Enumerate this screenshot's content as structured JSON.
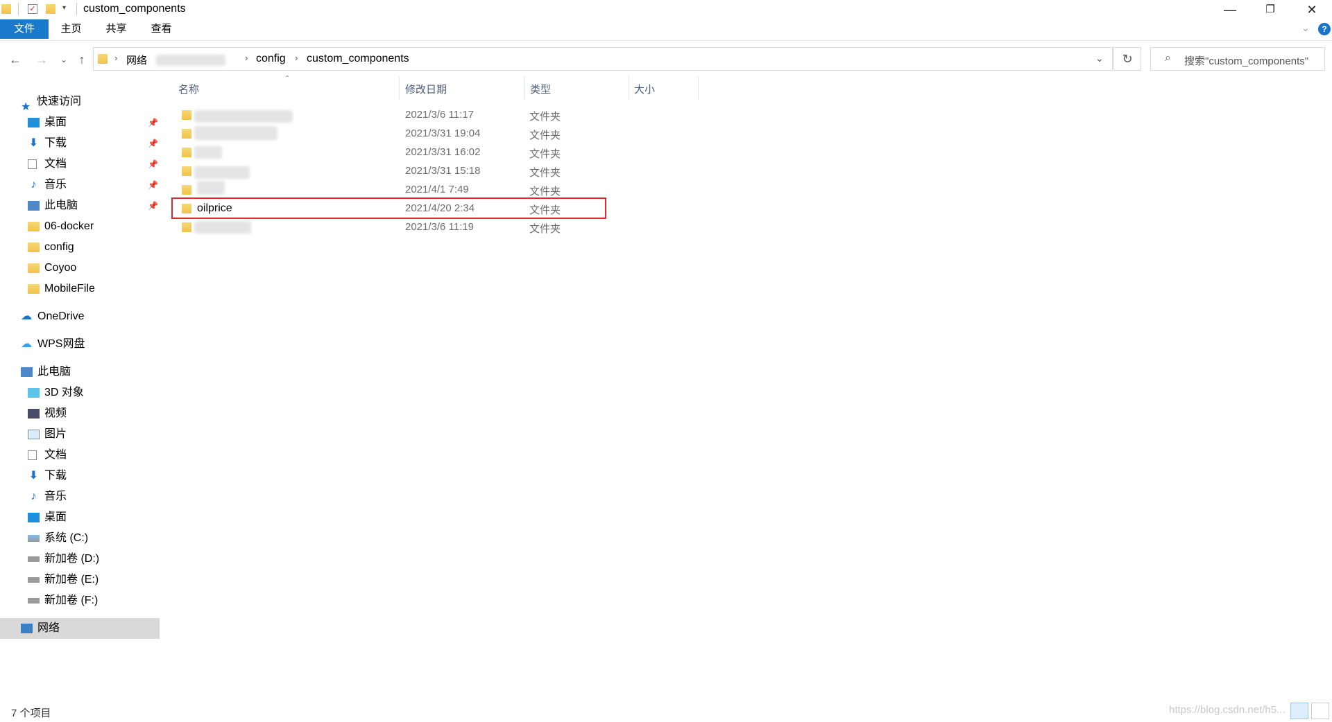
{
  "window": {
    "title": "custom_components",
    "controls": {
      "minimize": "—",
      "restore": "❐",
      "close": "✕"
    }
  },
  "ribbon": {
    "tabs": [
      "文件",
      "主页",
      "共享",
      "查看"
    ],
    "expand_icon": "chevron-down-icon",
    "help_icon": "?"
  },
  "address": {
    "path": [
      "网络",
      "config",
      "custom_components"
    ],
    "search_placeholder": "搜索\"custom_components\""
  },
  "sidebar": {
    "quick_access_label": "快速访问",
    "quick_access": [
      {
        "label": "桌面",
        "icon": "desktop-icon",
        "pinned": true
      },
      {
        "label": "下载",
        "icon": "download-icon",
        "pinned": true
      },
      {
        "label": "文档",
        "icon": "document-icon",
        "pinned": true
      },
      {
        "label": "音乐",
        "icon": "music-icon",
        "pinned": true
      },
      {
        "label": "此电脑",
        "icon": "computer-icon",
        "pinned": true
      },
      {
        "label": "06-docker",
        "icon": "folder-icon",
        "pinned": false
      },
      {
        "label": "config",
        "icon": "folder-icon",
        "pinned": false
      },
      {
        "label": "Coyoo",
        "icon": "folder-icon",
        "pinned": false
      },
      {
        "label": "MobileFile",
        "icon": "folder-icon",
        "pinned": false
      }
    ],
    "onedrive_label": "OneDrive",
    "wps_label": "WPS网盘",
    "this_pc_label": "此电脑",
    "this_pc": [
      {
        "label": "3D 对象",
        "icon": "3d-objects-icon"
      },
      {
        "label": "视频",
        "icon": "video-icon"
      },
      {
        "label": "图片",
        "icon": "picture-icon"
      },
      {
        "label": "文档",
        "icon": "document-icon"
      },
      {
        "label": "下载",
        "icon": "download-icon"
      },
      {
        "label": "音乐",
        "icon": "music-icon"
      },
      {
        "label": "桌面",
        "icon": "desktop-icon"
      },
      {
        "label": "系统 (C:)",
        "icon": "system-drive-icon"
      },
      {
        "label": "新加卷 (D:)",
        "icon": "drive-icon"
      },
      {
        "label": "新加卷 (E:)",
        "icon": "drive-icon"
      },
      {
        "label": "新加卷 (F:)",
        "icon": "drive-icon"
      }
    ],
    "network_label": "网络"
  },
  "columns": {
    "name": "名称",
    "modified": "修改日期",
    "type": "类型",
    "size": "大小"
  },
  "files": [
    {
      "name": "",
      "modified": "2021/3/6 11:17",
      "type": "文件夹"
    },
    {
      "name": "",
      "modified": "2021/3/31 19:04",
      "type": "文件夹"
    },
    {
      "name": "",
      "modified": "2021/3/31 16:02",
      "type": "文件夹"
    },
    {
      "name": "",
      "modified": "2021/3/31 15:18",
      "type": "文件夹"
    },
    {
      "name": "",
      "modified": "2021/4/1 7:49",
      "type": "文件夹"
    },
    {
      "name": "oilprice",
      "modified": "2021/4/20 2:34",
      "type": "文件夹",
      "highlighted": true
    },
    {
      "name": "",
      "modified": "2021/3/6 11:19",
      "type": "文件夹"
    }
  ],
  "status": {
    "item_count": "7 个项目"
  },
  "watermark": "https://blog.csdn.net/h5..."
}
